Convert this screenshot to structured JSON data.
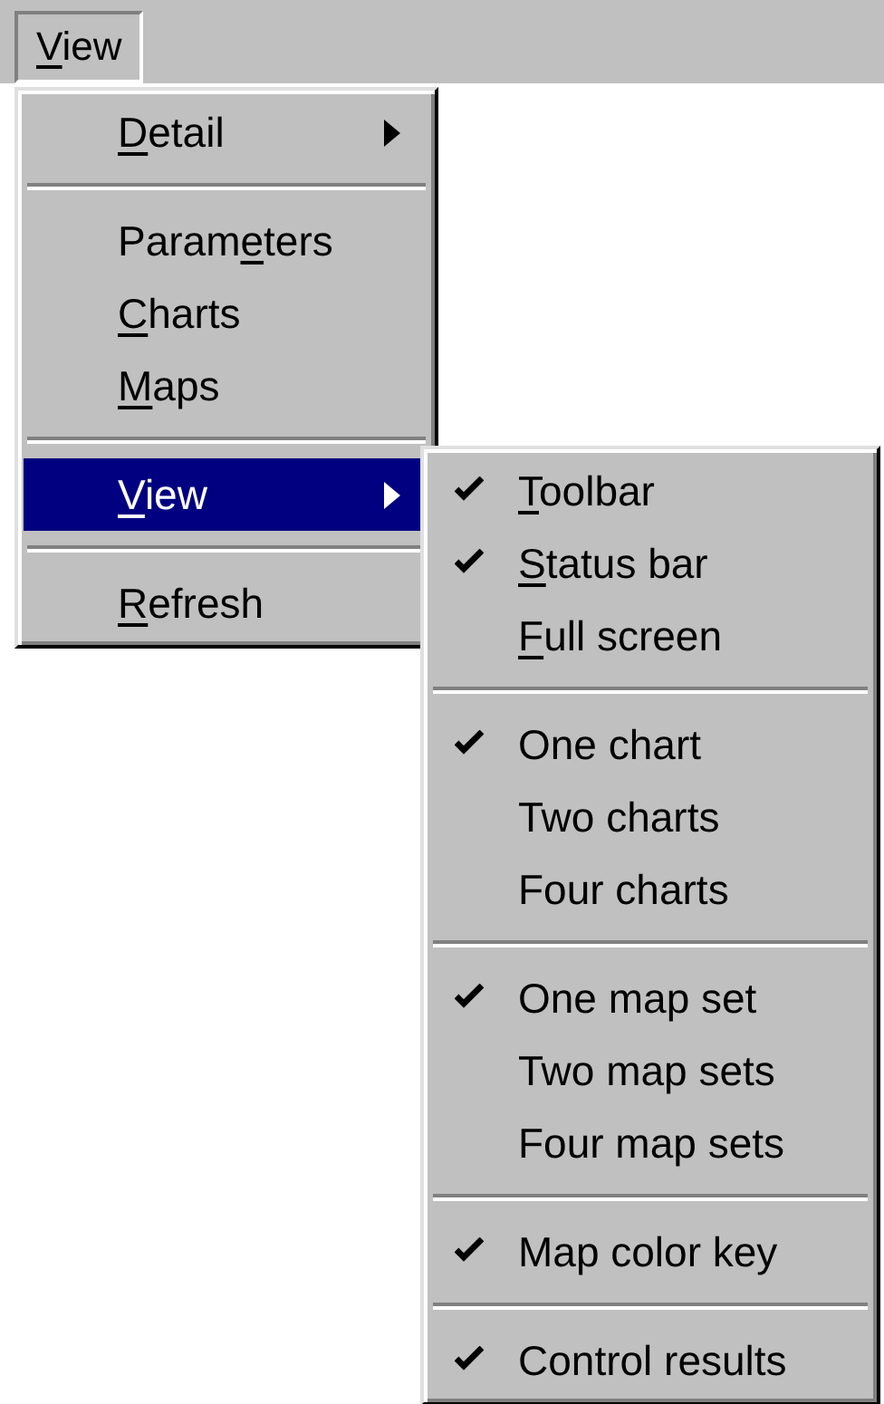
{
  "menu_bar": {
    "items": [
      {
        "access_key": "V",
        "text_after": "iew",
        "open": true
      }
    ]
  },
  "view_menu": {
    "items": [
      {
        "kind": "submenu",
        "access_key": "D",
        "text_after": "etail",
        "selected": false
      },
      {
        "kind": "separator"
      },
      {
        "kind": "item",
        "text_before": "Param",
        "access_key": "e",
        "text_after": "ters",
        "selected": false
      },
      {
        "kind": "item",
        "access_key": "C",
        "text_after": "harts",
        "selected": false
      },
      {
        "kind": "item",
        "access_key": "M",
        "text_after": "aps",
        "selected": false
      },
      {
        "kind": "separator"
      },
      {
        "kind": "submenu",
        "access_key": "V",
        "text_after": "iew",
        "selected": true
      },
      {
        "kind": "separator"
      },
      {
        "kind": "item",
        "access_key": "R",
        "text_after": "efresh",
        "selected": false
      }
    ]
  },
  "view_submenu": {
    "items": [
      {
        "kind": "item",
        "access_key": "T",
        "text_after": "oolbar",
        "checked": true
      },
      {
        "kind": "item",
        "access_key": "S",
        "text_after": "tatus bar",
        "checked": true
      },
      {
        "kind": "item",
        "access_key": "F",
        "text_after": "ull screen",
        "checked": false
      },
      {
        "kind": "separator"
      },
      {
        "kind": "item",
        "text_before": "One chart",
        "checked": true
      },
      {
        "kind": "item",
        "text_before": "Two charts",
        "checked": false
      },
      {
        "kind": "item",
        "text_before": "Four charts",
        "checked": false
      },
      {
        "kind": "separator"
      },
      {
        "kind": "item",
        "text_before": "One map set",
        "checked": true
      },
      {
        "kind": "item",
        "text_before": "Two map sets",
        "checked": false
      },
      {
        "kind": "item",
        "text_before": "Four map sets",
        "checked": false
      },
      {
        "kind": "separator"
      },
      {
        "kind": "item",
        "text_before": "Map color key",
        "checked": true
      },
      {
        "kind": "separator"
      },
      {
        "kind": "item",
        "text_before": "Control results",
        "checked": true
      }
    ]
  }
}
